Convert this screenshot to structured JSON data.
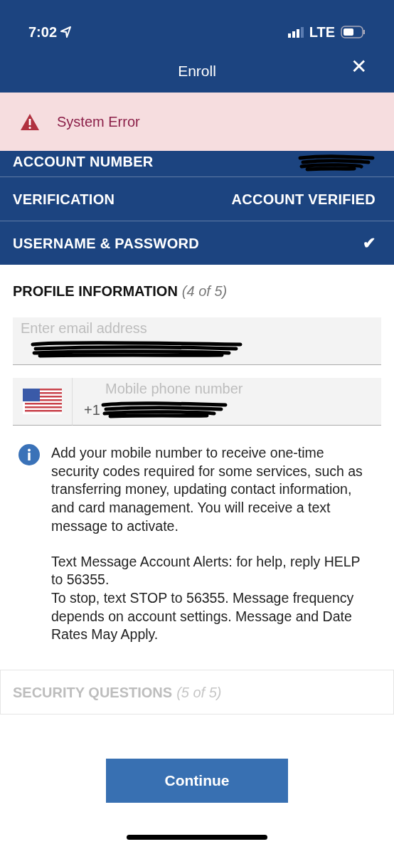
{
  "status_bar": {
    "time": "7:02",
    "network": "LTE"
  },
  "header": {
    "title": "Enroll",
    "close": "✕"
  },
  "alert": {
    "message": "System Error",
    "kind": "error"
  },
  "completed_steps": [
    {
      "label": "ACCOUNT NUMBER",
      "kind": "redacted"
    },
    {
      "label": "VERIFICATION",
      "kind": "status",
      "value": "ACCOUNT VERIFIED"
    },
    {
      "label": "USERNAME & PASSWORD",
      "kind": "check",
      "value": "✔"
    }
  ],
  "profile": {
    "title": "PROFILE INFORMATION",
    "count": "(4 of 5)",
    "disabled": false,
    "email": {
      "placeholder": "Enter email address",
      "redacted": true
    },
    "phone": {
      "placeholder": "Mobile phone number",
      "prefix": "+1",
      "redacted": true
    },
    "info": [
      "Add your mobile number to receive one-time security codes required for some services, such as transferring money, updating contact information, and card management. You will receive a text message to activate.",
      "Text Message Account Alerts: for help, reply HELP to 56355.\nTo stop, text STOP to 56355. Message frequency depends on account settings. Message and Date Rates May Apply."
    ]
  },
  "next_section": {
    "title": "SECURITY QUESTIONS",
    "count": "(5 of 5)",
    "disabled": true
  },
  "button": "Continue"
}
